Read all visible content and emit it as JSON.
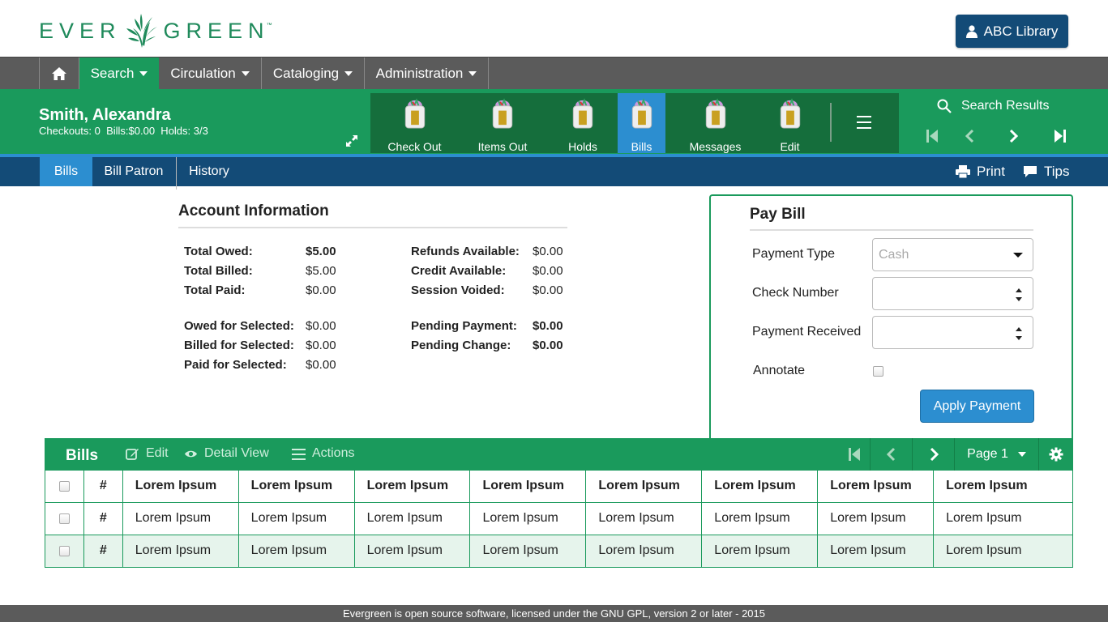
{
  "header": {
    "logo_left": "EVER",
    "logo_right": "GREEN",
    "logo_tm": "™",
    "library_button": "ABC Library"
  },
  "nav": {
    "home_icon": "home-icon",
    "items": [
      "Search",
      "Circulation",
      "Cataloging",
      "Administration"
    ]
  },
  "patron": {
    "name": "Smith, Alexandra",
    "stats": "Checkouts: 0  Bills:$0.00  Holds: 3/3",
    "tabs": [
      "Check Out",
      "Items Out",
      "Holds",
      "Bills",
      "Messages",
      "Edit"
    ],
    "active_tab": "Bills",
    "search_results": "Search Results"
  },
  "subnav": {
    "items": [
      "Bills",
      "Bill Patron",
      "History"
    ],
    "active": "Bills",
    "print": "Print",
    "tips": "Tips"
  },
  "account": {
    "title": "Account Information",
    "left": [
      {
        "label": "Total Owed:",
        "value": "$5.00",
        "bold": true
      },
      {
        "label": "Total Billed:",
        "value": "$5.00",
        "bold": false
      },
      {
        "label": "Total Paid:",
        "value": "$0.00",
        "bold": false
      },
      {
        "label": "Owed for Selected:",
        "value": "$0.00",
        "bold": false
      },
      {
        "label": "Billed for Selected:",
        "value": "$0.00",
        "bold": false
      },
      {
        "label": "Paid for Selected:",
        "value": "$0.00",
        "bold": false
      }
    ],
    "right": [
      {
        "label": "Refunds Available:",
        "value": "$0.00",
        "bold": false
      },
      {
        "label": "Credit Available:",
        "value": "$0.00",
        "bold": false
      },
      {
        "label": "Session Voided:",
        "value": "$0.00",
        "bold": false
      },
      {
        "label": "Pending Payment:",
        "value": "$0.00",
        "bold": true
      },
      {
        "label": "Pending Change:",
        "value": "$0.00",
        "bold": true
      }
    ]
  },
  "paybill": {
    "title": "Pay Bill",
    "payment_type_label": "Payment Type",
    "payment_type_value": "Cash",
    "check_number_label": "Check Number",
    "payment_received_label": "Payment Received",
    "annotate_label": "Annotate",
    "apply_button": "Apply Payment"
  },
  "grid": {
    "title": "Bills",
    "edit": "Edit",
    "detail_view": "Detail View",
    "actions": "Actions",
    "page": "Page 1",
    "columns": [
      "#",
      "Lorem Ipsum",
      "Lorem Ipsum",
      "Lorem Ipsum",
      "Lorem Ipsum",
      "Lorem Ipsum",
      "Lorem Ipsum",
      "Lorem Ipsum",
      "Lorem Ipsum"
    ],
    "rows": [
      [
        "#",
        "Lorem Ipsum",
        "Lorem Ipsum",
        "Lorem Ipsum",
        "Lorem Ipsum",
        "Lorem Ipsum",
        "Lorem Ipsum",
        "Lorem Ipsum",
        "Lorem Ipsum"
      ],
      [
        "#",
        "Lorem Ipsum",
        "Lorem Ipsum",
        "Lorem Ipsum",
        "Lorem Ipsum",
        "Lorem Ipsum",
        "Lorem Ipsum",
        "Lorem Ipsum",
        "Lorem Ipsum"
      ]
    ]
  },
  "footer": {
    "text": "Evergreen is open source software, licensed under the GNU GPL, version 2 or later - 2015"
  },
  "colors": {
    "green": "#1a9a5c",
    "dark_green": "#156e3c",
    "navy": "#134b77",
    "blue": "#2c8ed0",
    "gray": "#5b5b5b"
  }
}
